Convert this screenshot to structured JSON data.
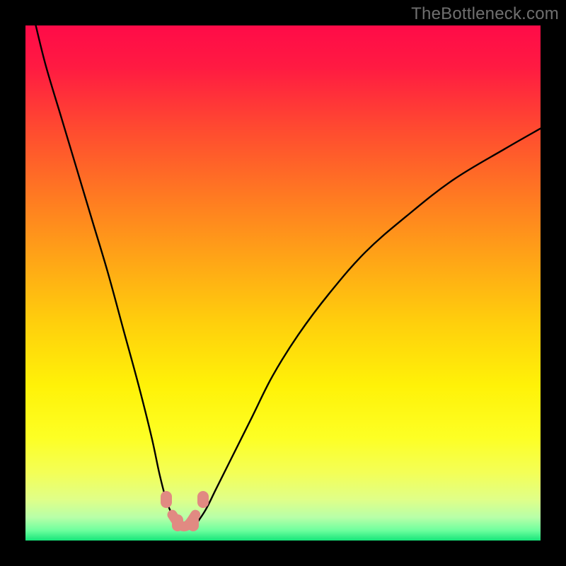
{
  "watermark": "TheBottleneck.com",
  "chart_data": {
    "type": "line",
    "title": "",
    "xlabel": "",
    "ylabel": "",
    "xlim": [
      0,
      100
    ],
    "ylim": [
      0,
      100
    ],
    "grid": false,
    "legend": false,
    "series": [
      {
        "name": "left-curve",
        "x": [
          2,
          4,
          7,
          10,
          13,
          16,
          19,
          22,
          24.5,
          26,
          27.3,
          28.5,
          30
        ],
        "values": [
          100,
          92,
          82,
          72,
          62,
          52,
          41,
          30,
          20,
          13,
          8,
          5,
          3
        ]
      },
      {
        "name": "right-curve",
        "x": [
          33,
          35,
          37,
          40,
          44,
          48,
          53,
          59,
          66,
          74,
          83,
          93,
          100
        ],
        "values": [
          3,
          6,
          10,
          16,
          24,
          32,
          40,
          48,
          56,
          63,
          70,
          76,
          80
        ]
      },
      {
        "name": "valley-floor",
        "x": [
          28.5,
          30,
          31.5,
          33
        ],
        "values": [
          5,
          3,
          3,
          5
        ]
      }
    ],
    "markers": [
      {
        "name": "marker-left",
        "x": 27.3,
        "y": 8
      },
      {
        "name": "marker-right",
        "x": 34.5,
        "y": 8
      },
      {
        "name": "marker-floor-left",
        "x": 29.5,
        "y": 3.5
      },
      {
        "name": "marker-floor-right",
        "x": 32.5,
        "y": 3.5
      }
    ],
    "gradient_stops": [
      {
        "offset": 0.0,
        "color": "#ff0b48"
      },
      {
        "offset": 0.08,
        "color": "#ff1a42"
      },
      {
        "offset": 0.2,
        "color": "#ff4a30"
      },
      {
        "offset": 0.33,
        "color": "#ff7922"
      },
      {
        "offset": 0.46,
        "color": "#ffa716"
      },
      {
        "offset": 0.58,
        "color": "#ffd00c"
      },
      {
        "offset": 0.7,
        "color": "#fff208"
      },
      {
        "offset": 0.8,
        "color": "#fdff24"
      },
      {
        "offset": 0.87,
        "color": "#f3ff58"
      },
      {
        "offset": 0.92,
        "color": "#e0ff88"
      },
      {
        "offset": 0.955,
        "color": "#b8ffa8"
      },
      {
        "offset": 0.98,
        "color": "#6fff9e"
      },
      {
        "offset": 1.0,
        "color": "#16e57a"
      }
    ]
  }
}
